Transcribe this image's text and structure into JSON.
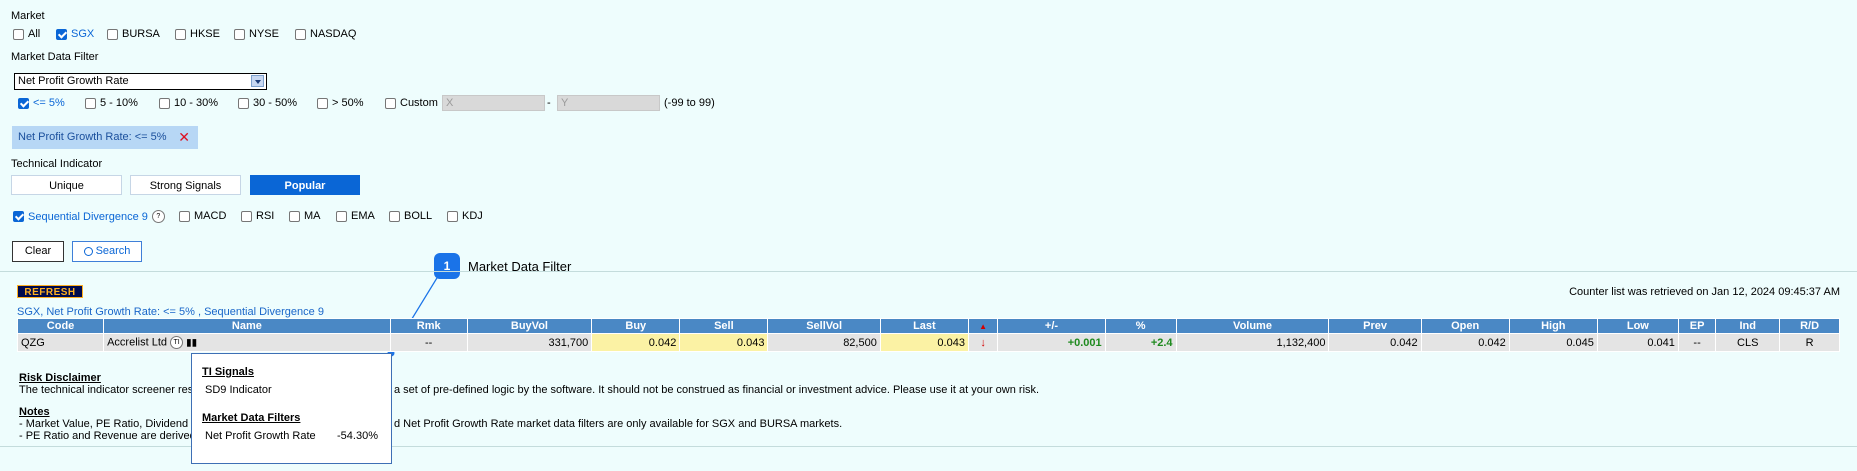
{
  "market": {
    "label": "Market",
    "options": [
      {
        "label": "All",
        "checked": false
      },
      {
        "label": "SGX",
        "checked": true
      },
      {
        "label": "BURSA",
        "checked": false
      },
      {
        "label": "HKSE",
        "checked": false
      },
      {
        "label": "NYSE",
        "checked": false
      },
      {
        "label": "NASDAQ",
        "checked": false
      }
    ]
  },
  "filter": {
    "label": "Market Data Filter",
    "selected": "Net Profit Growth Rate",
    "ranges": [
      {
        "label": "<= 5%",
        "checked": true
      },
      {
        "label": "5 - 10%",
        "checked": false
      },
      {
        "label": "10 - 30%",
        "checked": false
      },
      {
        "label": "30 - 50%",
        "checked": false
      },
      {
        "label": "> 50%",
        "checked": false
      },
      {
        "label": "Custom",
        "checked": false
      }
    ],
    "custom_x_placeholder": "X",
    "custom_dash": "-",
    "custom_y_placeholder": "Y",
    "custom_hint": "(-99 to 99)",
    "active_tag": "Net Profit Growth Rate: <= 5%"
  },
  "technical": {
    "label": "Technical Indicator",
    "tabs": [
      "Unique",
      "Strong Signals",
      "Popular"
    ],
    "active_tab": "Popular",
    "indicators": [
      {
        "label": "Sequential Divergence 9",
        "checked": true
      },
      {
        "label": "MACD",
        "checked": false
      },
      {
        "label": "RSI",
        "checked": false
      },
      {
        "label": "MA",
        "checked": false
      },
      {
        "label": "EMA",
        "checked": false
      },
      {
        "label": "BOLL",
        "checked": false
      },
      {
        "label": "KDJ",
        "checked": false
      }
    ],
    "help_glyph": "?"
  },
  "actions": {
    "clear": "Clear",
    "search": "Search"
  },
  "annotation": {
    "number": "1",
    "text": "Market Data Filter"
  },
  "results": {
    "refresh": "REFRESH",
    "summary": "SGX, Net Profit Growth Rate: <= 5%  , Sequential Divergence 9",
    "retrieved": "Counter list was retrieved on Jan 12, 2024 09:45:37 AM",
    "columns": [
      "Code",
      "Name",
      "Rmk",
      "BuyVol",
      "Buy",
      "Sell",
      "SellVol",
      "Last",
      "▲",
      "+/-",
      "%",
      "Volume",
      "Prev",
      "Open",
      "High",
      "Low",
      "EP",
      "Ind",
      "R/D"
    ],
    "rows": [
      {
        "code": "QZG",
        "name": "Accrelist Ltd",
        "ti": "TI",
        "rmk": "--",
        "buyvol": "331,700",
        "buy": "0.042",
        "sell": "0.043",
        "sellvol": "82,500",
        "last": "0.043",
        "dir": "↓",
        "change": "+0.001",
        "pct": "+2.4",
        "volume": "1,132,400",
        "prev": "0.042",
        "open": "0.042",
        "high": "0.045",
        "low": "0.041",
        "ep": "--",
        "ind": "CLS",
        "rd": "R"
      }
    ]
  },
  "disclaimer": {
    "title": "Risk Disclaimer",
    "text_left": "The technical indicator screener res",
    "text_right": "a set of pre-defined logic by the software. It should not be construed as financial or investment advice. Please use it at your own risk."
  },
  "notes": {
    "title": "Notes",
    "line1_left": "- Market Value, PE Ratio, Dividend Y",
    "line1_right": "d Net Profit Growth Rate market data filters are only available for SGX and BURSA markets.",
    "line2_left": "- PE Ratio and Revenue are derived"
  },
  "tooltip": {
    "ti_title": "TI Signals",
    "ti_item": "SD9 Indicator",
    "mdf_title": "Market Data Filters",
    "mdf_label": "Net Profit Growth Rate",
    "mdf_value": "-54.30%"
  },
  "colors": {
    "accent": "#0a66d6",
    "header": "#4a88c5",
    "highlight": "#fbf2a4",
    "background": "#eefdfd"
  }
}
